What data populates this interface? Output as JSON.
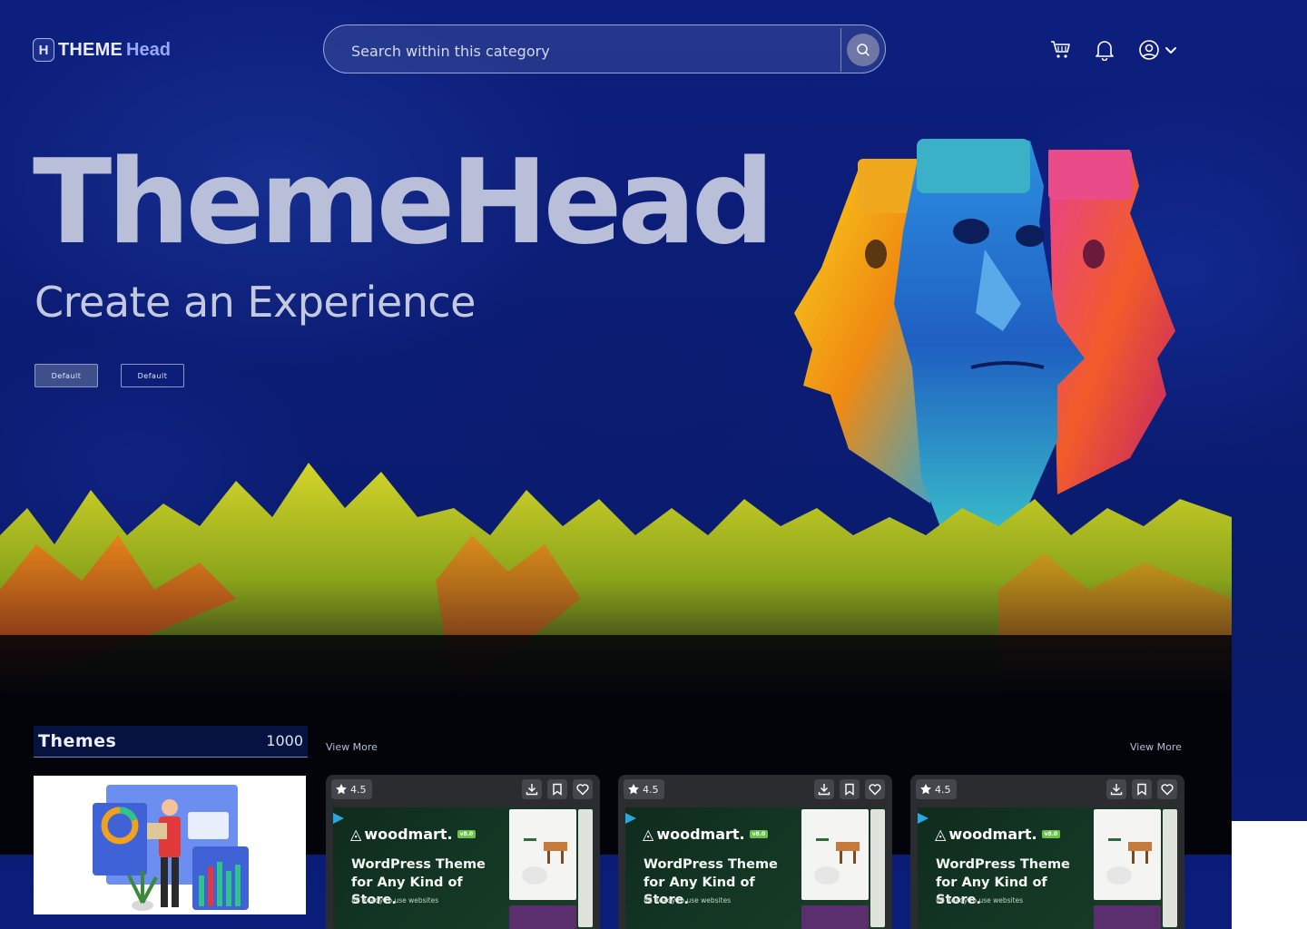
{
  "header": {
    "logo_theme": "THEME",
    "logo_head": "Head",
    "logo_mark": "H",
    "search_placeholder": "Search within this category",
    "icons": [
      "cart-icon",
      "bell-icon",
      "user-icon",
      "chevron-down-icon"
    ]
  },
  "hero": {
    "title": "ThemeHead",
    "subtitle": "Create an Experience",
    "buttons": [
      {
        "label": "Default",
        "style": "filled"
      },
      {
        "label": "Default",
        "style": "outline"
      }
    ]
  },
  "themes_panel": {
    "title": "Themes",
    "count": "1000"
  },
  "view_more_left": "View More",
  "view_more_right": "View More",
  "cards": [
    {
      "rating": "4.5",
      "brand": "woodmart.",
      "version": "v8.0",
      "headline_1": "WordPress Theme",
      "headline_2": "for Any Kind of Store.",
      "tagline": "88 Ready to use websites"
    },
    {
      "rating": "4.5",
      "brand": "woodmart.",
      "version": "v8.0",
      "headline_1": "WordPress Theme",
      "headline_2": "for Any Kind of Store.",
      "tagline": "88 Ready to use websites"
    },
    {
      "rating": "4.5",
      "brand": "woodmart.",
      "version": "v8.0",
      "headline_1": "WordPress Theme",
      "headline_2": "for Any Kind of Store.",
      "tagline": "88 Ready to use websites"
    }
  ],
  "colors": {
    "background": "#0a1f78",
    "dark_section": "#020409",
    "card": "#2b2c30",
    "accent": "#9aa7ff"
  }
}
